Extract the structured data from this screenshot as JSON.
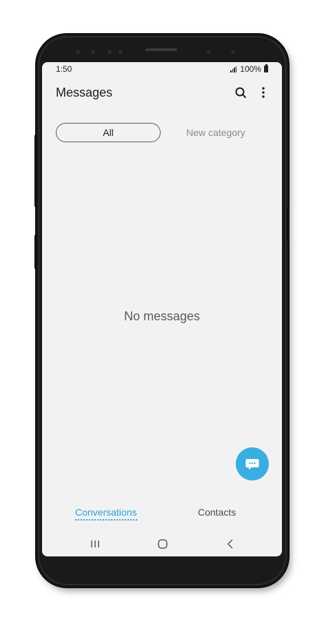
{
  "status_bar": {
    "time": "1:50",
    "battery": "100%",
    "icons": [
      "signal-icon",
      "battery-icon"
    ]
  },
  "header": {
    "title": "Messages",
    "icons": [
      "search-icon",
      "more-vertical-icon"
    ]
  },
  "category_tabs": [
    {
      "label": "All",
      "selected": true
    },
    {
      "label": "New category",
      "selected": false
    }
  ],
  "empty_state": {
    "text": "No messages"
  },
  "fab": {
    "icon": "compose-message-icon",
    "color": "#3aaee0"
  },
  "bottom_tabs": [
    {
      "label": "Conversations",
      "active": true
    },
    {
      "label": "Contacts",
      "active": false
    }
  ],
  "nav_bar": {
    "icons": [
      "recent-apps-icon",
      "home-icon",
      "back-icon"
    ]
  },
  "colors": {
    "accent": "#2a9fd6",
    "background": "#f2f2f2"
  }
}
